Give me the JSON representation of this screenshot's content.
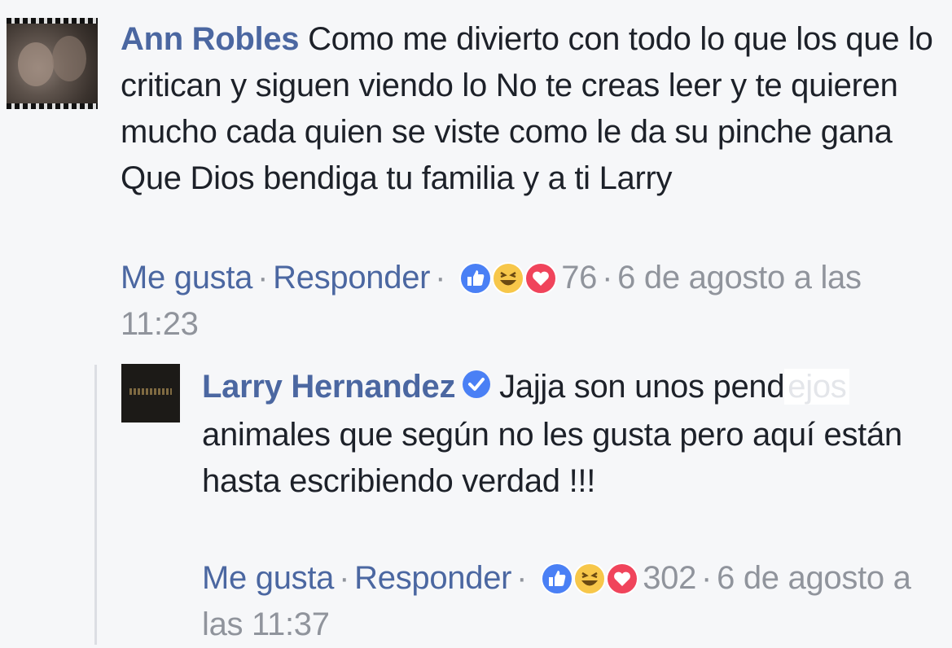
{
  "comments": [
    {
      "author": "Ann Robles",
      "text": "Como me divierto con todo lo que los que lo critican y siguen viendo lo No te creas leer y te quieren mucho cada quien se viste como le da su pinche gana Que Dios bendiga tu familia y a ti Larry",
      "like_label": "Me gusta",
      "reply_label": "Responder",
      "reaction_count": "76",
      "timestamp": "6 de agosto a las 11:23",
      "reactions": [
        "like-icon",
        "haha-icon",
        "love-icon"
      ]
    },
    {
      "author": "Larry Hernandez",
      "verified": true,
      "text_before": "Jajja son unos pend",
      "text_redacted": "ejos",
      "text_after": " animales que según no les gusta pero aquí están hasta escribiendo verdad !!!",
      "like_label": "Me gusta",
      "reply_label": "Responder",
      "reaction_count": "302",
      "timestamp": "6 de agosto a las 11:37",
      "reactions": [
        "like-icon",
        "haha-icon",
        "love-icon"
      ]
    }
  ],
  "colors": {
    "link": "#4b67a1",
    "meta": "#90949c",
    "background": "#f6f7f9",
    "like_blue": "#4a80f5",
    "haha_yellow": "#f7c74a",
    "love_red": "#f0445b"
  }
}
